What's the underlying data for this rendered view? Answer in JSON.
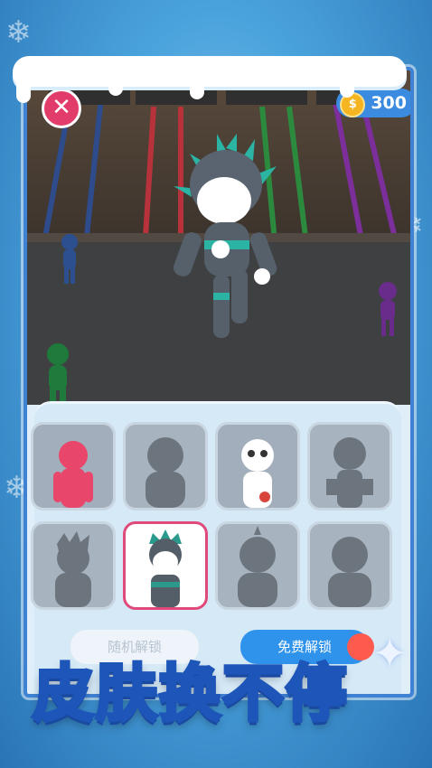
{
  "hud": {
    "close_icon": "close-icon",
    "coin_icon": "dollar-coin-icon",
    "coins": "300"
  },
  "skins": [
    {
      "state": "owned",
      "color": "#e8466a"
    },
    {
      "state": "locked",
      "color": "#6c757e"
    },
    {
      "state": "owned",
      "color": "#ffffff"
    },
    {
      "state": "locked",
      "color": "#6c757e"
    },
    {
      "state": "locked",
      "color": "#6c757e"
    },
    {
      "state": "selected",
      "color": "#2b9a8c"
    },
    {
      "state": "locked",
      "color": "#6c757e"
    },
    {
      "state": "locked",
      "color": "#6c757e"
    }
  ],
  "buttons": {
    "random_unlock": "随机解锁",
    "free_unlock": "免费解锁"
  },
  "banner": {
    "title": "皮肤换不停"
  },
  "colors": {
    "accent_blue": "#2f93ec",
    "close_red": "#e23c6a",
    "selected_border": "#e04a7a"
  }
}
